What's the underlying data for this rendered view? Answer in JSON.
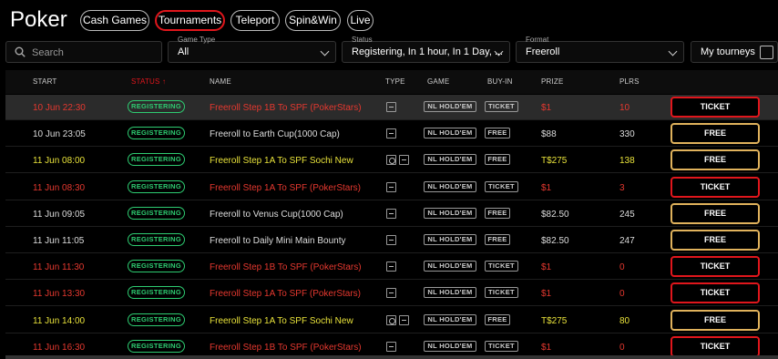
{
  "app": {
    "title": "Poker"
  },
  "nav": [
    {
      "label": "Cash Games",
      "active": false
    },
    {
      "label": "Tournaments",
      "active": true
    },
    {
      "label": "Teleport",
      "active": false
    },
    {
      "label": "Spin&Win",
      "active": false
    },
    {
      "label": "Live",
      "active": false
    }
  ],
  "filters": {
    "search_placeholder": "Search",
    "game_type": {
      "label": "Game Type",
      "value": "All"
    },
    "status": {
      "label": "Status",
      "value": "Registering, In 1 hour, In 1 Day, ..."
    },
    "format": {
      "label": "Format",
      "value": "Freeroll"
    },
    "my_tourneys": "My tourneys"
  },
  "table": {
    "headers": {
      "start": "START",
      "status": "STATUS ↑",
      "name": "NAME",
      "type": "TYPE",
      "game": "GAME",
      "buyin": "BUY-IN",
      "prize": "PRIZE",
      "plrs": "PLRS"
    },
    "rows": [
      {
        "start": "10 Jun 22:30",
        "status": "REGISTERING",
        "name": "Freeroll Step 1B To SPF (PokerStars)",
        "game": "NL HOLD'EM",
        "buyin": "TICKET",
        "prize": "$1",
        "plrs": "10",
        "action": "TICKET",
        "color": "red",
        "icons": [
          "ticket"
        ],
        "highlight": true
      },
      {
        "start": "10 Jun 23:05",
        "status": "REGISTERING",
        "name": "Freeroll to Earth Cup(1000 Cap)",
        "game": "NL HOLD'EM",
        "buyin": "FREE",
        "prize": "$88",
        "plrs": "330",
        "action": "FREE",
        "color": "white",
        "icons": [
          "ticket"
        ],
        "highlight": false
      },
      {
        "start": "11 Jun 08:00",
        "status": "REGISTERING",
        "name": "Freeroll Step 1A To SPF Sochi New",
        "game": "NL HOLD'EM",
        "buyin": "FREE",
        "prize": "T$275",
        "plrs": "138",
        "action": "FREE",
        "color": "yellow",
        "icons": [
          "gear",
          "ticket"
        ],
        "highlight": false
      },
      {
        "start": "11 Jun 08:30",
        "status": "REGISTERING",
        "name": "Freeroll Step 1A To SPF (PokerStars)",
        "game": "NL HOLD'EM",
        "buyin": "TICKET",
        "prize": "$1",
        "plrs": "3",
        "action": "TICKET",
        "color": "red",
        "icons": [
          "ticket"
        ],
        "highlight": false
      },
      {
        "start": "11 Jun 09:05",
        "status": "REGISTERING",
        "name": "Freeroll to Venus Cup(1000 Cap)",
        "game": "NL HOLD'EM",
        "buyin": "FREE",
        "prize": "$82.50",
        "plrs": "245",
        "action": "FREE",
        "color": "white",
        "icons": [
          "ticket"
        ],
        "highlight": false
      },
      {
        "start": "11 Jun 11:05",
        "status": "REGISTERING",
        "name": "Freeroll to Daily Mini Main Bounty",
        "game": "NL HOLD'EM",
        "buyin": "FREE",
        "prize": "$82.50",
        "plrs": "247",
        "action": "FREE",
        "color": "white",
        "icons": [
          "ticket"
        ],
        "highlight": false
      },
      {
        "start": "11 Jun 11:30",
        "status": "REGISTERING",
        "name": "Freeroll Step 1B To SPF (PokerStars)",
        "game": "NL HOLD'EM",
        "buyin": "TICKET",
        "prize": "$1",
        "plrs": "0",
        "action": "TICKET",
        "color": "red",
        "icons": [
          "ticket"
        ],
        "highlight": false
      },
      {
        "start": "11 Jun 13:30",
        "status": "REGISTERING",
        "name": "Freeroll Step 1A To SPF (PokerStars)",
        "game": "NL HOLD'EM",
        "buyin": "TICKET",
        "prize": "$1",
        "plrs": "0",
        "action": "TICKET",
        "color": "red",
        "icons": [
          "ticket"
        ],
        "highlight": false
      },
      {
        "start": "11 Jun 14:00",
        "status": "REGISTERING",
        "name": "Freeroll Step 1A To SPF Sochi New",
        "game": "NL HOLD'EM",
        "buyin": "FREE",
        "prize": "T$275",
        "plrs": "80",
        "action": "FREE",
        "color": "yellow",
        "icons": [
          "gear",
          "ticket"
        ],
        "highlight": false
      },
      {
        "start": "11 Jun 16:30",
        "status": "REGISTERING",
        "name": "Freeroll Step 1B To SPF (PokerStars)",
        "game": "NL HOLD'EM",
        "buyin": "TICKET",
        "prize": "$1",
        "plrs": "0",
        "action": "TICKET",
        "color": "red",
        "icons": [
          "ticket"
        ],
        "highlight": false
      }
    ]
  },
  "colors": {
    "accent_red": "#e0161c",
    "status_green": "#2ecc71",
    "free_gold": "#e0b25c",
    "name_red": "#e5382f",
    "name_yellow": "#e8e23a"
  }
}
